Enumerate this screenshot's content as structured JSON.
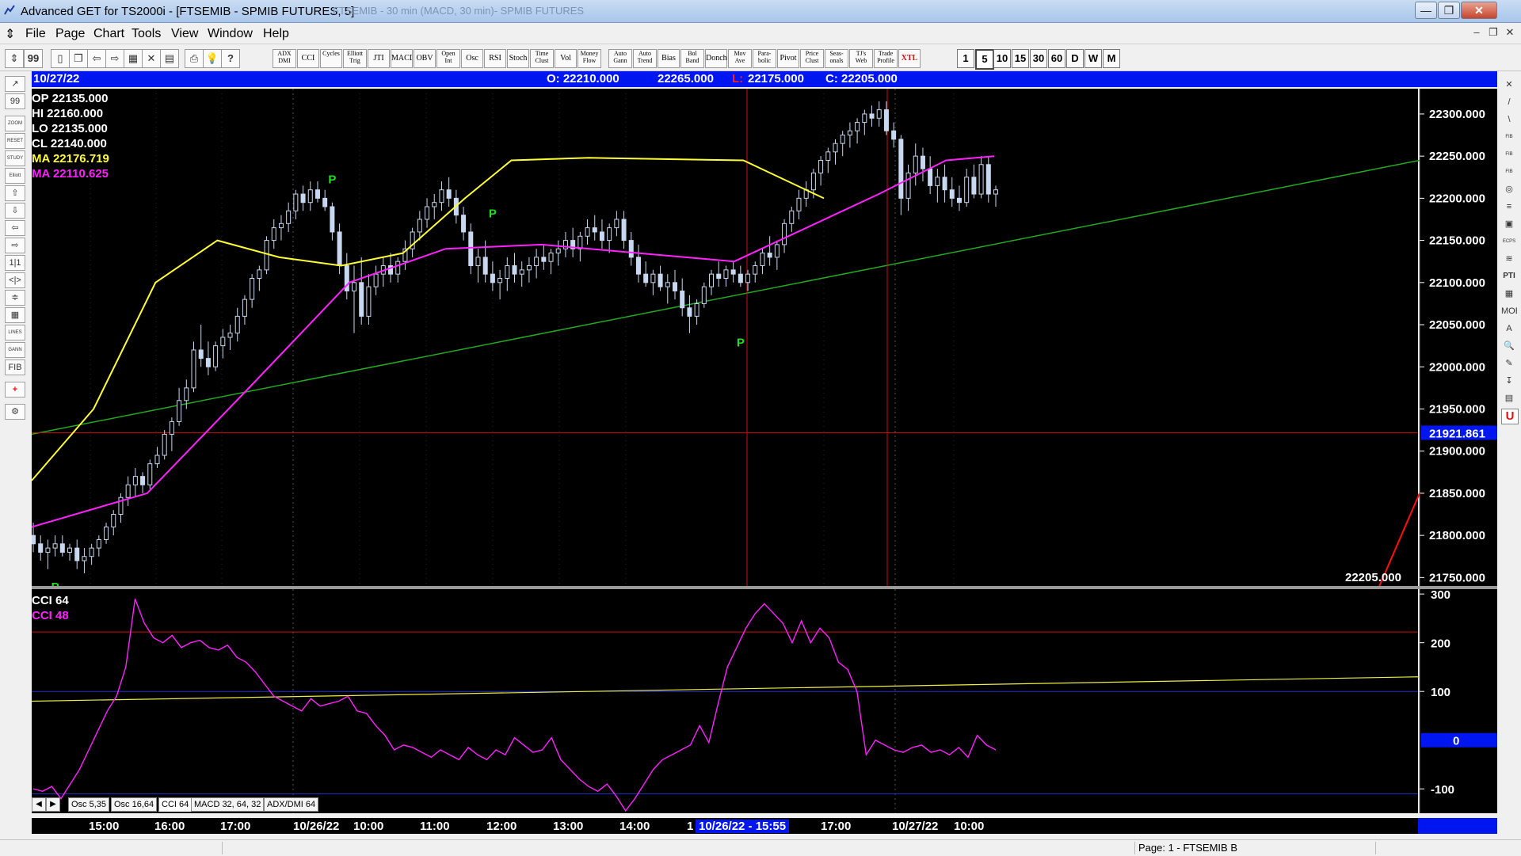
{
  "window": {
    "title": "Advanced GET for TS2000i - [FTSEMIB - SPMIB FUTURES, 5]",
    "ghost_title": "FTSEMIB - 30 min (MACD, 30 min)- SPMIB FUTURES",
    "minimize": "—",
    "restore": "❐",
    "close": "✕"
  },
  "menu": {
    "items": [
      "File",
      "Page",
      "Chart",
      "Tools",
      "View",
      "Window",
      "Help"
    ],
    "mdi_min": "–",
    "mdi_restore": "❐",
    "mdi_close": "✕"
  },
  "toolbar": {
    "study_buttons": [
      "ADX DMI",
      "CCI",
      "Cycles",
      "Elliott Trig",
      "JTI",
      "MACD",
      "OBV",
      "Open Int",
      "Osc",
      "RSI",
      "Stoch",
      "Time Clust",
      "Vol",
      "Money Flow",
      "Auto Gann",
      "Auto Trend",
      "Bias",
      "Bol Band",
      "Donch",
      "Mov Ave",
      "Para-bolic",
      "Pivot",
      "Price Clust",
      "Seas-onals",
      "TJ's Web",
      "Trade Profile",
      "XTL"
    ],
    "timeframes": [
      "1",
      "5",
      "10",
      "15",
      "30",
      "60",
      "D",
      "W",
      "M"
    ],
    "active_timeframe": "5"
  },
  "left_tools": [
    "↗",
    "99",
    "ZOOM",
    "RESET",
    "STUDY",
    "Elliott",
    "⇧",
    "⇩",
    "⇦",
    "⇨",
    "1|1",
    "<|>",
    "≑",
    "▦",
    "LINES",
    "GANN",
    "FIB",
    "+",
    "⚙"
  ],
  "right_tools": [
    "✕",
    "/",
    "\\",
    "FIB RET",
    "FIB EXT",
    "FIB TIME",
    "◎",
    "≡",
    "▣",
    "ECPS",
    "≋",
    "PTI",
    "▦",
    "MOB",
    "A",
    "🔍",
    "✎",
    "↧",
    "▤",
    "U"
  ],
  "infobar": {
    "date": "10/27/22",
    "open": "O: 22210.000",
    "high": "22265.000",
    "low_label": "L:",
    "low_value": "22175.000",
    "close": "C: 22205.000"
  },
  "readout": {
    "op": "OP  22135.000",
    "hi": "HI  22160.000",
    "lo": "LO  22135.000",
    "cl": "CL  22140.000",
    "ma1": "MA  22176.719",
    "ma2": "MA  22110.625"
  },
  "colors": {
    "price_bars": "#c8d8f0",
    "ma_fast": "#ffff33",
    "ma_slow": "#ff22ff",
    "trend_green": "#22aa22",
    "trend_red": "#ff1010",
    "cursor_red": "#cc1111",
    "pivot": "#22dd22",
    "info_blue": "#0016f0"
  },
  "price_axis": {
    "labels": [
      "22300.000",
      "22250.000",
      "22200.000",
      "22150.000",
      "22100.000",
      "22050.000",
      "22000.000",
      "21950.000",
      "21900.000",
      "21850.000",
      "21800.000",
      "21750.000"
    ],
    "cursor_label": "21921.861",
    "last_close": "22205.000"
  },
  "pivot_label": "P",
  "cci": {
    "title1": "CCI 64",
    "title2": "CCI  48",
    "axis": [
      "300",
      "200",
      "100",
      "0",
      "-100"
    ],
    "zero_label": "0"
  },
  "tabs": [
    "Osc 5,35",
    "Osc 16,64",
    "CCI 64",
    "MACD 32, 64, 32",
    "ADX/DMI 64"
  ],
  "active_tab": "CCI 64",
  "time_axis": {
    "labels": [
      "15:00",
      "16:00",
      "17:00",
      "10/26/22",
      "10:00",
      "11:00",
      "12:00",
      "13:00",
      "14:00",
      "1",
      "17:00",
      "10/27/22",
      "10:00"
    ],
    "cursor_label": "10/26/22 - 15:55"
  },
  "status": {
    "page": "Page: 1 - FTSEMIB B"
  },
  "chart_data": {
    "type": "candlestick",
    "title": "FTSEMIB - SPMIB FUTURES, 5",
    "ylim": [
      21740,
      22330
    ],
    "bars": [
      [
        21800,
        21815,
        21780,
        21790
      ],
      [
        21790,
        21800,
        21770,
        21780
      ],
      [
        21780,
        21795,
        21760,
        21785
      ],
      [
        21785,
        21800,
        21775,
        21790
      ],
      [
        21790,
        21800,
        21775,
        21780
      ],
      [
        21780,
        21790,
        21770,
        21785
      ],
      [
        21785,
        21795,
        21760,
        21770
      ],
      [
        21770,
        21785,
        21755,
        21775
      ],
      [
        21775,
        21790,
        21765,
        21785
      ],
      [
        21785,
        21800,
        21775,
        21795
      ],
      [
        21795,
        21815,
        21790,
        21810
      ],
      [
        21810,
        21830,
        21800,
        21825
      ],
      [
        21825,
        21850,
        21815,
        21845
      ],
      [
        21845,
        21870,
        21835,
        21860
      ],
      [
        21860,
        21880,
        21845,
        21870
      ],
      [
        21870,
        21875,
        21850,
        21860
      ],
      [
        21860,
        21890,
        21855,
        21885
      ],
      [
        21885,
        21905,
        21880,
        21895
      ],
      [
        21895,
        21925,
        21890,
        21920
      ],
      [
        21920,
        21940,
        21900,
        21935
      ],
      [
        21935,
        21975,
        21930,
        21960
      ],
      [
        21960,
        21985,
        21950,
        21975
      ],
      [
        21975,
        22030,
        21970,
        22020
      ],
      [
        22020,
        22050,
        22000,
        22010
      ],
      [
        22010,
        22030,
        21990,
        22000
      ],
      [
        22000,
        22030,
        21995,
        22025
      ],
      [
        22025,
        22045,
        22010,
        22035
      ],
      [
        22035,
        22050,
        22020,
        22040
      ],
      [
        22040,
        22070,
        22030,
        22060
      ],
      [
        22060,
        22085,
        22050,
        22080
      ],
      [
        22080,
        22110,
        22070,
        22105
      ],
      [
        22105,
        22120,
        22090,
        22115
      ],
      [
        22115,
        22155,
        22110,
        22150
      ],
      [
        22150,
        22175,
        22140,
        22165
      ],
      [
        22165,
        22180,
        22150,
        22170
      ],
      [
        22170,
        22195,
        22160,
        22185
      ],
      [
        22185,
        22210,
        22175,
        22205
      ],
      [
        22205,
        22215,
        22185,
        22195
      ],
      [
        22195,
        22220,
        22185,
        22210
      ],
      [
        22210,
        22220,
        22195,
        22200
      ],
      [
        22200,
        22210,
        22185,
        22190
      ],
      [
        22190,
        22195,
        22150,
        22160
      ],
      [
        22160,
        22170,
        22110,
        22120
      ],
      [
        22120,
        22135,
        22080,
        22090
      ],
      [
        22090,
        22120,
        22040,
        22100
      ],
      [
        22100,
        22130,
        22050,
        22060
      ],
      [
        22060,
        22110,
        22050,
        22095
      ],
      [
        22095,
        22120,
        22085,
        22110
      ],
      [
        22110,
        22130,
        22095,
        22120
      ],
      [
        22120,
        22135,
        22100,
        22110
      ],
      [
        22110,
        22130,
        22100,
        22125
      ],
      [
        22125,
        22150,
        22115,
        22140
      ],
      [
        22140,
        22165,
        22130,
        22160
      ],
      [
        22160,
        22185,
        22150,
        22175
      ],
      [
        22175,
        22200,
        22165,
        22190
      ],
      [
        22190,
        22205,
        22175,
        22195
      ],
      [
        22195,
        22220,
        22185,
        22210
      ],
      [
        22210,
        22225,
        22190,
        22200
      ],
      [
        22200,
        22210,
        22170,
        22180
      ],
      [
        22180,
        22190,
        22150,
        22160
      ],
      [
        22160,
        22170,
        22110,
        22120
      ],
      [
        22120,
        22140,
        22100,
        22130
      ],
      [
        22130,
        22150,
        22100,
        22110
      ],
      [
        22110,
        22125,
        22090,
        22100
      ],
      [
        22100,
        22115,
        22080,
        22105
      ],
      [
        22105,
        22130,
        22090,
        22120
      ],
      [
        22120,
        22135,
        22100,
        22110
      ],
      [
        22110,
        22125,
        22095,
        22115
      ],
      [
        22115,
        22130,
        22100,
        22120
      ],
      [
        22120,
        22140,
        22105,
        22130
      ],
      [
        22130,
        22145,
        22115,
        22125
      ],
      [
        22125,
        22140,
        22110,
        22135
      ],
      [
        22135,
        22150,
        22120,
        22140
      ],
      [
        22140,
        22160,
        22130,
        22150
      ],
      [
        22150,
        22165,
        22130,
        22140
      ],
      [
        22140,
        22160,
        22125,
        22155
      ],
      [
        22155,
        22175,
        22145,
        22165
      ],
      [
        22165,
        22180,
        22150,
        22160
      ],
      [
        22160,
        22175,
        22140,
        22150
      ],
      [
        22150,
        22170,
        22135,
        22165
      ],
      [
        22165,
        22185,
        22155,
        22175
      ],
      [
        22175,
        22185,
        22140,
        22150
      ],
      [
        22150,
        22160,
        22120,
        22130
      ],
      [
        22130,
        22145,
        22100,
        22110
      ],
      [
        22110,
        22125,
        22095,
        22100
      ],
      [
        22100,
        22115,
        22085,
        22110
      ],
      [
        22110,
        22120,
        22090,
        22095
      ],
      [
        22095,
        22110,
        22075,
        22100
      ],
      [
        22100,
        22115,
        22080,
        22090
      ],
      [
        22090,
        22105,
        22060,
        22070
      ],
      [
        22070,
        22085,
        22040,
        22060
      ],
      [
        22060,
        22080,
        22050,
        22075
      ],
      [
        22075,
        22100,
        22070,
        22095
      ],
      [
        22095,
        22115,
        22085,
        22110
      ],
      [
        22110,
        22125,
        22095,
        22105
      ],
      [
        22105,
        22120,
        22095,
        22115
      ],
      [
        22115,
        22125,
        22100,
        22110
      ],
      [
        22110,
        22120,
        22095,
        22100
      ],
      [
        22100,
        22115,
        22090,
        22110
      ],
      [
        22110,
        22125,
        22100,
        22120
      ],
      [
        22120,
        22140,
        22110,
        22135
      ],
      [
        22135,
        22155,
        22120,
        22130
      ],
      [
        22130,
        22150,
        22115,
        22145
      ],
      [
        22145,
        22175,
        22135,
        22170
      ],
      [
        22170,
        22190,
        22160,
        22185
      ],
      [
        22185,
        22210,
        22175,
        22200
      ],
      [
        22200,
        22220,
        22190,
        22210
      ],
      [
        22210,
        22235,
        22200,
        22230
      ],
      [
        22230,
        22250,
        22215,
        22245
      ],
      [
        22245,
        22260,
        22230,
        22255
      ],
      [
        22255,
        22270,
        22240,
        22265
      ],
      [
        22265,
        22280,
        22250,
        22275
      ],
      [
        22275,
        22290,
        22260,
        22280
      ],
      [
        22280,
        22295,
        22265,
        22290
      ],
      [
        22290,
        22305,
        22275,
        22300
      ],
      [
        22300,
        22310,
        22285,
        22295
      ],
      [
        22295,
        22315,
        22285,
        22305
      ],
      [
        22305,
        22315,
        22275,
        22280
      ],
      [
        22280,
        22290,
        22260,
        22270
      ],
      [
        22270,
        22275,
        22180,
        22200
      ],
      [
        22200,
        22240,
        22185,
        22230
      ],
      [
        22230,
        22265,
        22215,
        22250
      ],
      [
        22250,
        22260,
        22220,
        22235
      ],
      [
        22235,
        22250,
        22205,
        22215
      ],
      [
        22215,
        22235,
        22195,
        22225
      ],
      [
        22225,
        22240,
        22195,
        22210
      ],
      [
        22210,
        22225,
        22190,
        22200
      ],
      [
        22200,
        22215,
        22185,
        22195
      ],
      [
        22195,
        22235,
        22190,
        22225
      ],
      [
        22225,
        22240,
        22200,
        22205
      ],
      [
        22205,
        22250,
        22200,
        22240
      ],
      [
        22240,
        22250,
        22195,
        22205
      ],
      [
        22205,
        22215,
        22190,
        22210
      ]
    ],
    "ma_fast": [
      [
        0,
        21865
      ],
      [
        20,
        21950
      ],
      [
        40,
        22100
      ],
      [
        60,
        22150
      ],
      [
        80,
        22130
      ],
      [
        100,
        22120
      ],
      [
        120,
        22135
      ],
      [
        140,
        22200
      ],
      [
        155,
        22245
      ],
      [
        180,
        22248
      ],
      [
        230,
        22245
      ],
      [
        256,
        22200
      ]
    ],
    "ma_slow": [
      [
        0,
        21810
      ],
      [
        60,
        21850
      ],
      [
        115,
        21980
      ],
      [
        165,
        22100
      ],
      [
        215,
        22140
      ],
      [
        265,
        22145
      ],
      [
        315,
        22135
      ],
      [
        365,
        22125
      ],
      [
        440,
        22205
      ],
      [
        475,
        22245
      ],
      [
        500,
        22250
      ]
    ],
    "trend_green": [
      [
        21920,
        0
      ],
      [
        22245,
        1
      ]
    ],
    "trend_red": [
      [
        21740,
        0.64
      ],
      [
        21850,
        1
      ]
    ],
    "cursor_price": 21921.861,
    "pivots": [
      {
        "idx": 3,
        "price": 21755,
        "pos": "below"
      },
      {
        "idx": 41,
        "price": 22210,
        "pos": "above"
      },
      {
        "idx": 63,
        "price": 22170,
        "pos": "above"
      },
      {
        "idx": 97,
        "price": 22045,
        "pos": "below"
      }
    ],
    "cci_ylim": [
      -150,
      310
    ],
    "cci_levels": [
      222,
      100,
      0,
      -110
    ],
    "cci_values": [
      -100,
      -105,
      -95,
      -120,
      -90,
      -60,
      -20,
      20,
      60,
      90,
      150,
      290,
      240,
      210,
      200,
      215,
      190,
      200,
      205,
      190,
      185,
      195,
      170,
      160,
      140,
      115,
      90,
      80,
      70,
      60,
      85,
      70,
      75,
      80,
      90,
      60,
      55,
      30,
      10,
      -20,
      -10,
      -15,
      -25,
      -35,
      -20,
      -30,
      -40,
      -15,
      -30,
      -40,
      -20,
      -30,
      5,
      -10,
      -25,
      -20,
      5,
      -40,
      -60,
      -80,
      -95,
      -105,
      -90,
      -115,
      -145,
      -120,
      -90,
      -60,
      -40,
      -30,
      -20,
      -10,
      30,
      -5,
      75,
      150,
      190,
      230,
      260,
      280,
      260,
      240,
      200,
      245,
      200,
      230,
      210,
      160,
      145,
      100,
      -30,
      0,
      -10,
      -20,
      -25,
      -15,
      -10,
      -25,
      -20,
      -30,
      -15,
      -35,
      10,
      -10,
      -20
    ],
    "cci_signal": [
      [
        0,
        80
      ],
      [
        1,
        130
      ]
    ]
  }
}
